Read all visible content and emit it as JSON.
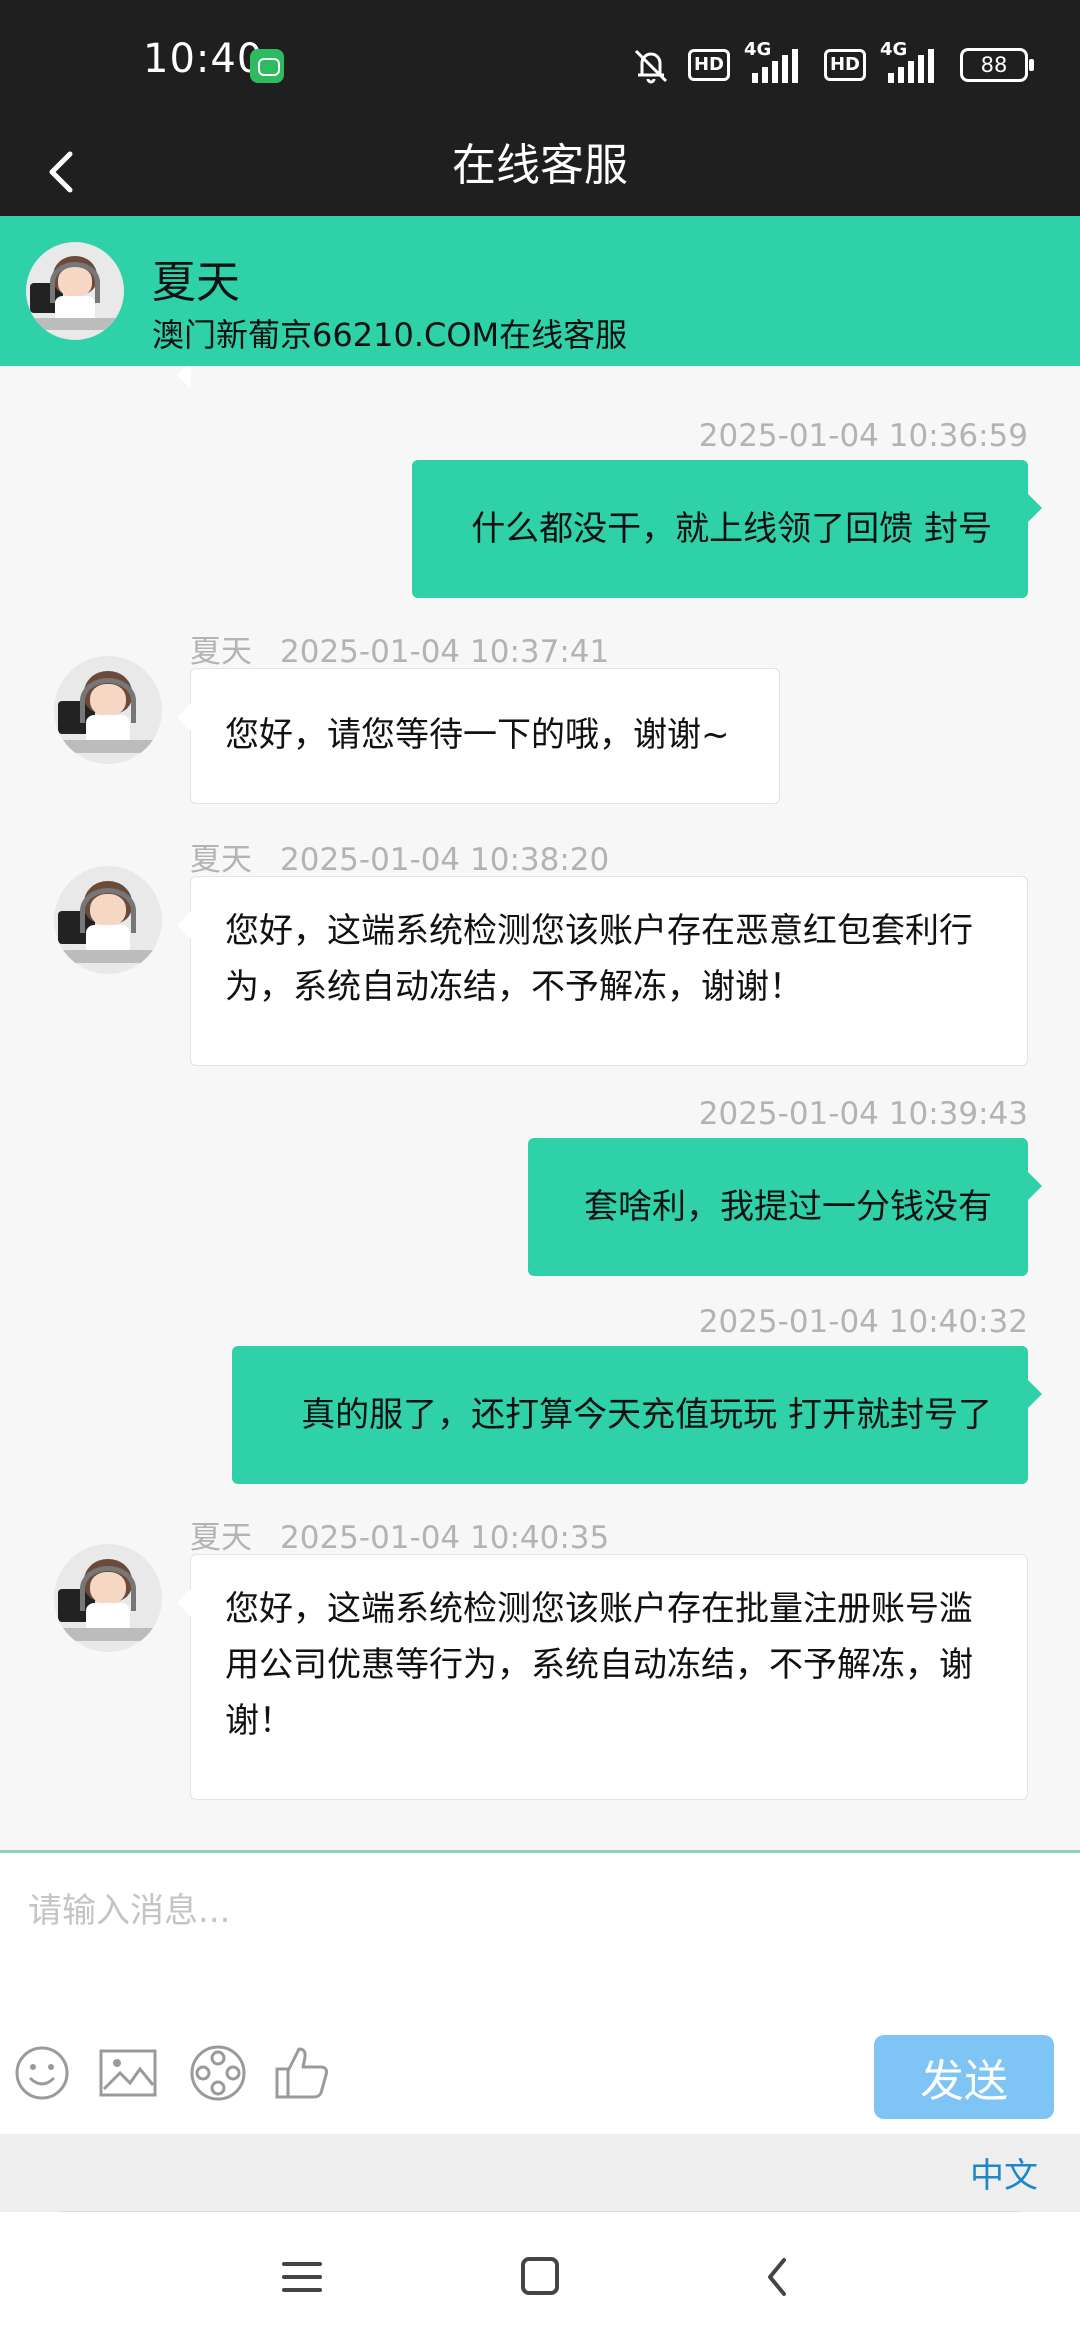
{
  "status_bar": {
    "time": "10:40",
    "network_1": "4G",
    "network_2": "4G",
    "hd_1": "HD",
    "hd_2": "HD",
    "battery": "88"
  },
  "header": {
    "title": "在线客服"
  },
  "agent": {
    "name": "夏天",
    "subtitle": "澳门新葡京66210.COM在线客服"
  },
  "messages": [
    {
      "sender": "user",
      "timestamp": "2025-01-04 10:36:59",
      "text": "什么都没干，就上线领了回馈 封号"
    },
    {
      "sender": "agent",
      "name": "夏天",
      "timestamp": "2025-01-04 10:37:41",
      "text": "您好，请您等待一下的哦，谢谢~"
    },
    {
      "sender": "agent",
      "name": "夏天",
      "timestamp": "2025-01-04 10:38:20",
      "text": "您好，这端系统检测您该账户存在恶意红包套利行为，系统自动冻结，不予解冻，谢谢！"
    },
    {
      "sender": "user",
      "timestamp": "2025-01-04 10:39:43",
      "text": "套啥利，我提过一分钱没有"
    },
    {
      "sender": "user",
      "timestamp": "2025-01-04 10:40:32",
      "text": "真的服了，还打算今天充值玩玩 打开就封号了"
    },
    {
      "sender": "agent",
      "name": "夏天",
      "timestamp": "2025-01-04 10:40:35",
      "text": "您好，这端系统检测您该账户存在批量注册账号滥用公司优惠等行为，系统自动冻结，不予解冻，谢谢！"
    }
  ],
  "input": {
    "placeholder": "请输入消息..."
  },
  "toolbar": {
    "icons": [
      "emoji-icon",
      "image-icon",
      "video-icon",
      "thumbs-up-icon"
    ],
    "send_label": "发送"
  },
  "language": {
    "label": "中文"
  },
  "colors": {
    "accent": "#2fd1a8",
    "send_button": "#7ec4f5",
    "status_bar": "#1f1f1f",
    "language_link": "#1e88c7"
  }
}
